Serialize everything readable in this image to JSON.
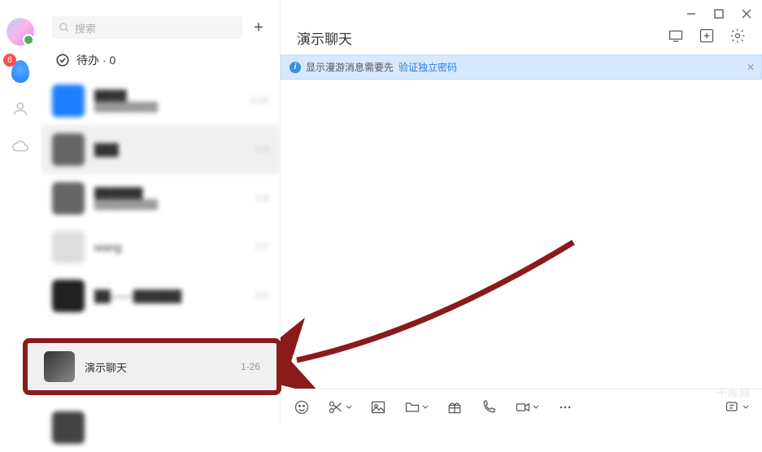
{
  "rail": {
    "badge_count": "6"
  },
  "sidebar": {
    "search_placeholder": "搜索",
    "pending_label": "待办 · 0",
    "chats": [
      {
        "name": "████",
        "sub": "██████████",
        "time": "2-10"
      },
      {
        "name": "███",
        "sub": "",
        "time": "2-9"
      },
      {
        "name": "██████",
        "sub": "██████████",
        "time": "2-8"
      },
      {
        "name": "wang",
        "sub": "",
        "time": "2-7"
      },
      {
        "name": "██——██████",
        "sub": "",
        "time": "2-4"
      }
    ],
    "highlighted_chat": {
      "name": "演示聊天",
      "time": "1-26"
    }
  },
  "main": {
    "title": "演示聊天",
    "notice_text": "显示漫游消息需要先",
    "notice_link": "验证独立密码"
  },
  "watermark": "千库网",
  "annotation": {
    "highlight_color": "#8b1a1a"
  }
}
